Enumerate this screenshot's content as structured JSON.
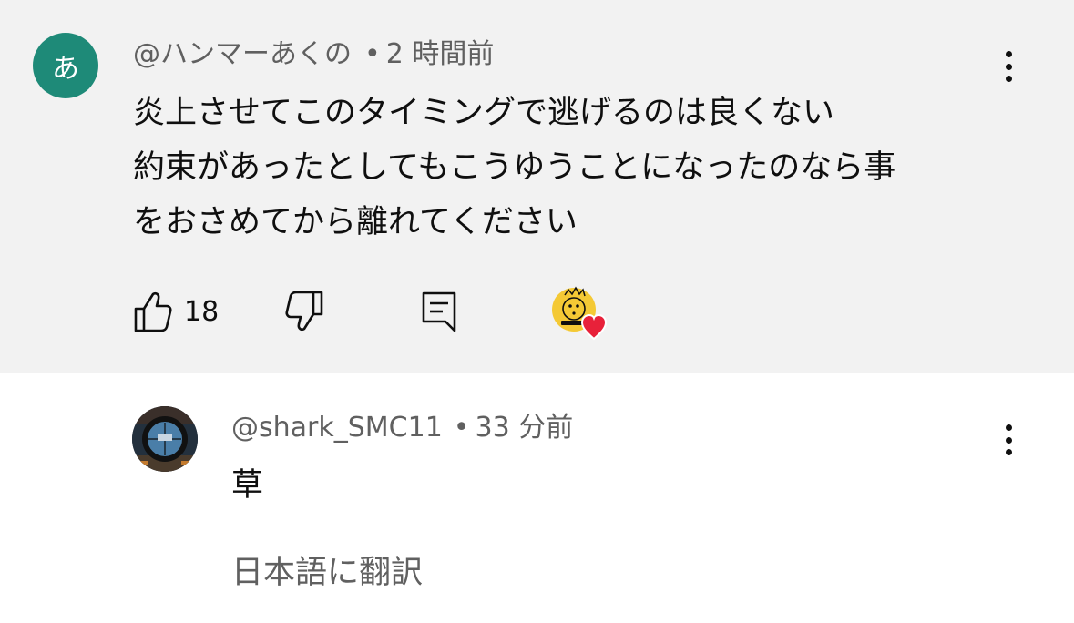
{
  "comment": {
    "avatar_letter": "あ",
    "avatar_color": "#1e8a78",
    "author": "@ハンマーあくの",
    "separator": "•",
    "time": "2 時間前",
    "lines": [
      "炎上させてこのタイミングで逃げるのは良くない",
      "約束があったとしてもこうゆうことになったのなら事",
      "をおさめてから離れてください"
    ],
    "like_count": "18",
    "icons": {
      "like": "thumbs-up-icon",
      "dislike": "thumbs-down-icon",
      "reply": "reply-icon",
      "more": "more-vert-icon",
      "creator_heart": "creator-heart-icon"
    }
  },
  "reply": {
    "author": "@shark_SMC11",
    "separator": "•",
    "time": "33 分前",
    "text": "草",
    "translate_label": "日本語に翻訳"
  }
}
